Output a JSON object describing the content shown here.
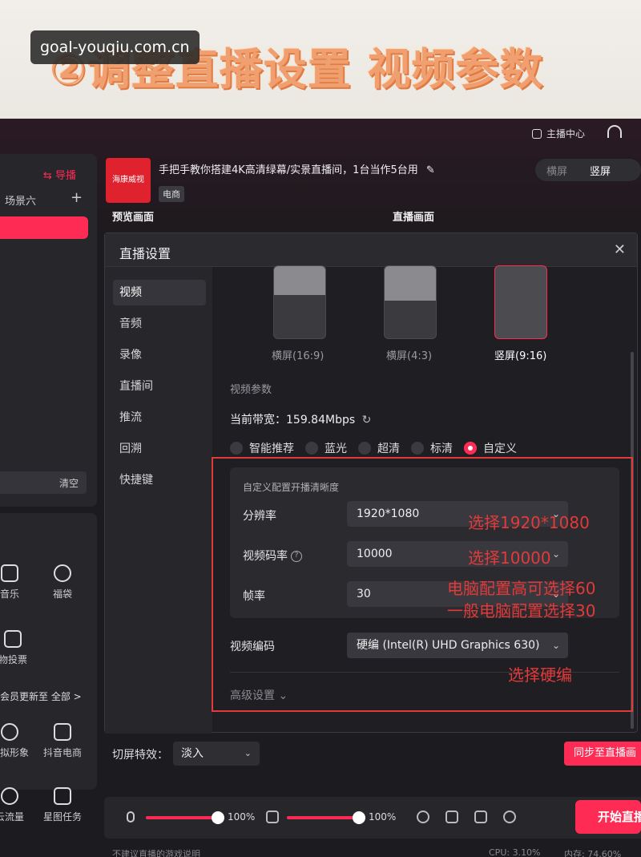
{
  "banner": {
    "title": "②调整直播设置 视频参数",
    "watermark": "goal-youqiu.com.cn"
  },
  "header": {
    "anchor_center": "主播中心"
  },
  "sidebar": {
    "guide": "导播",
    "scene": "场景六",
    "clear": "清空",
    "tools": [
      {
        "label": "音乐",
        "icon": "music-icon"
      },
      {
        "label": "福袋",
        "icon": "gift-bag-icon"
      },
      {
        "label": "物投票",
        "icon": "chart-icon"
      },
      {
        "label": "虚拟形象",
        "icon": "avatar-icon"
      },
      {
        "label": "抖音电商",
        "icon": "cart-icon"
      },
      {
        "label": "云流量",
        "icon": "share-icon"
      },
      {
        "label": "星图任务",
        "icon": "star-map-icon"
      }
    ],
    "member_update": "会员更新至",
    "all": "全部 >"
  },
  "live_info": {
    "logo_text": "海康威视",
    "title": "手把手教你搭建4K高清绿幕/实景直播间，1台当作5台用",
    "tag": "电商",
    "orient_options": [
      "横屏",
      "竖屏"
    ],
    "preview_label": "预览画面",
    "live_label": "直播画面"
  },
  "dialog": {
    "title": "直播设置",
    "close": "✕",
    "nav": [
      "视频",
      "音频",
      "录像",
      "直播间",
      "推流",
      "回溯",
      "快捷键"
    ],
    "active_nav": "视频",
    "ratios": [
      {
        "label": "横屏(16:9)",
        "fill": 0.4,
        "selected": false
      },
      {
        "label": "横屏(4:3)",
        "fill": 0.48,
        "selected": false
      },
      {
        "label": "竖屏(9:16)",
        "fill": 0,
        "selected": true
      }
    ],
    "section_label": "视频参数",
    "bandwidth_label": "当前带宽：",
    "bandwidth_value": "159.84Mbps",
    "quality_options": [
      "智能推荐",
      "蓝光",
      "超清",
      "标清",
      "自定义"
    ],
    "quality_selected": "自定义",
    "custom_title": "自定义配置开播清晰度",
    "resolution_label": "分辨率",
    "resolution_value": "1920*1080",
    "bitrate_label": "视频码率",
    "bitrate_value": "10000",
    "framerate_label": "帧率",
    "framerate_value": "30",
    "encoder_label": "视频编码",
    "encoder_value": "硬编 (Intel(R) UHD Graphics 630)",
    "advanced": "高级设置"
  },
  "annotations": {
    "res": "选择1920*1080",
    "bitrate": "选择10000",
    "fps_high": "电脑配置高可选择60",
    "fps_low": "一般电脑配置选择30",
    "encoder": "选择硬编"
  },
  "bottom": {
    "switch_label": "切屏特效：",
    "switch_value": "淡入",
    "sync_button": "同步至直播画",
    "mic_volume": "100%",
    "speaker_volume": "100%",
    "start_button": "开始直播",
    "status_left": "不建议直播的游戏说明",
    "status_cpu": "CPU: 3.10%",
    "status_mem": "内存: 74.60%"
  },
  "colors": {
    "accent": "#fe2c55",
    "annotation": "#e23a3a"
  }
}
